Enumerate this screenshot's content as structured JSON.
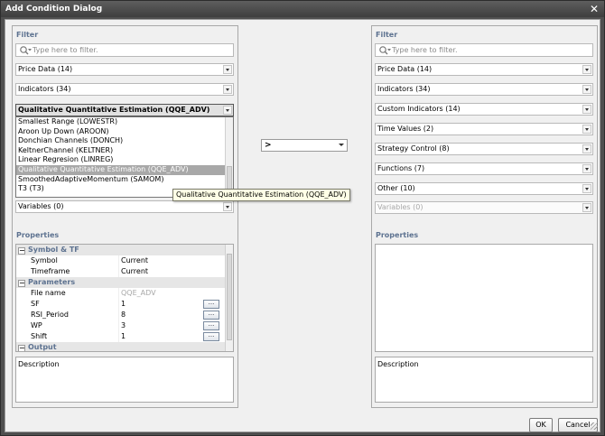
{
  "window": {
    "title": "Add Condition Dialog"
  },
  "left": {
    "filter_label": "Filter",
    "filter_placeholder": "Type here to filter.",
    "combos": [
      "Price Data (14)",
      "Indicators (34)"
    ],
    "selected_combo": "Qualitative Quantitative Estimation (QQE_ADV)",
    "dropdown_items": [
      "Smallest Range (LOWESTR)",
      "Aroon Up Down (AROON)",
      "Donchian Channels (DONCH)",
      "KeltnerChannel (KELTNER)",
      "Linear Regresion (LINREG)",
      "Qualitative Quantitative Estimation (QQE_ADV)",
      "SmoothedAdaptiveMomentum (SAMOM)",
      "T3 (T3)"
    ],
    "active_item_index": 5,
    "variables_combo": "Variables (0)",
    "properties_label": "Properties",
    "properties": {
      "symbol_tf": {
        "header": "Symbol & TF",
        "rows": [
          {
            "name": "Symbol",
            "value": "Current"
          },
          {
            "name": "Timeframe",
            "value": "Current"
          }
        ]
      },
      "parameters": {
        "header": "Parameters",
        "rows": [
          {
            "name": "File name",
            "value": "QQE_ADV"
          },
          {
            "name": "SF",
            "value": "1"
          },
          {
            "name": "RSI_Period",
            "value": "8"
          },
          {
            "name": "WP",
            "value": "3"
          },
          {
            "name": "Shift",
            "value": "1"
          }
        ]
      },
      "output": {
        "header": "Output"
      }
    },
    "description_label": "Description"
  },
  "tooltip": "Qualitative Quantitative Estimation (QQE_ADV)",
  "operator": {
    "value": ">"
  },
  "right": {
    "filter_label": "Filter",
    "filter_placeholder": "Type here to filter.",
    "combos": [
      "Price Data (14)",
      "Indicators (34)",
      "Custom Indicators (14)",
      "Time Values (2)",
      "Strategy Control (8)",
      "Functions (7)",
      "Other (10)"
    ],
    "variables_combo": "Variables (0)",
    "properties_label": "Properties",
    "description_label": "Description"
  },
  "buttons": {
    "ok": "OK",
    "cancel": "Cancel"
  },
  "icons": {
    "close": "close-icon",
    "search": "search-icon",
    "ellipsis": "..."
  },
  "colors": {
    "section_label": "#5d7290",
    "titlebar": "#4f4f4f",
    "active_item": "#a8a8a8",
    "tooltip_bg": "#ffffe6"
  }
}
